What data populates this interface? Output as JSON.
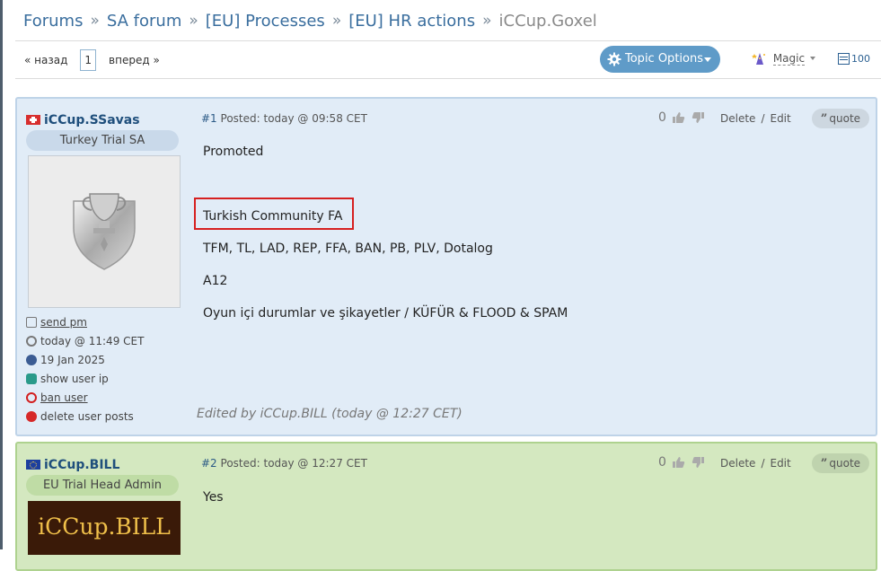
{
  "breadcrumb": {
    "items": [
      "Forums",
      "SA forum",
      "[EU] Processes",
      "[EU] HR actions"
    ],
    "current": "iCCup.Goxel",
    "separator": "»"
  },
  "pagination": {
    "prev_label": "« назад",
    "current_page": "1",
    "next_label": "вперед »"
  },
  "toolbar": {
    "topic_options_label": "Topic Options",
    "magic_label": "Magic",
    "per_page": "100"
  },
  "posts": [
    {
      "number": "#1",
      "posted_text": "Posted: today @ 09:58 CET",
      "username": "iCCup.SSavas",
      "flag": "switzerland-flag-icon",
      "rank": "Turkey Trial SA",
      "votes": "0",
      "delete_label": "Delete",
      "edit_label": "Edit",
      "quote_label": "quote",
      "meta": {
        "send_pm": "send pm",
        "last_seen": "today @ 11:49 CET",
        "joined": "19 Jan 2025",
        "show_ip": "show user ip",
        "ban_user": "ban user",
        "delete_posts": "delete user posts"
      },
      "body": [
        "Promoted",
        "Turkish Community FA",
        "TFM, TL, LAD, REP, FFA, BAN, PB, PLV, Dotalog",
        "A12",
        "Oyun içi durumlar ve şikayetler / KÜFÜR & FLOOD & SPAM"
      ],
      "edited": "Edited by iCCup.BILL (today @ 12:27 CET)"
    },
    {
      "number": "#2",
      "posted_text": "Posted: today @ 12:27 CET",
      "username": "iCCup.BILL",
      "flag": "eu-flag-icon",
      "rank": "EU Trial Head Admin",
      "avatar_text": "iCCup.BILL",
      "votes": "0",
      "delete_label": "Delete",
      "edit_label": "Edit",
      "quote_label": "quote",
      "body": [
        "Yes"
      ]
    }
  ],
  "colors": {
    "post1_bg": "#e1ecf7",
    "post2_bg": "#d4e8c0",
    "link": "#3a6e9e",
    "button": "#5f9bc8",
    "highlight": "#d62020"
  }
}
